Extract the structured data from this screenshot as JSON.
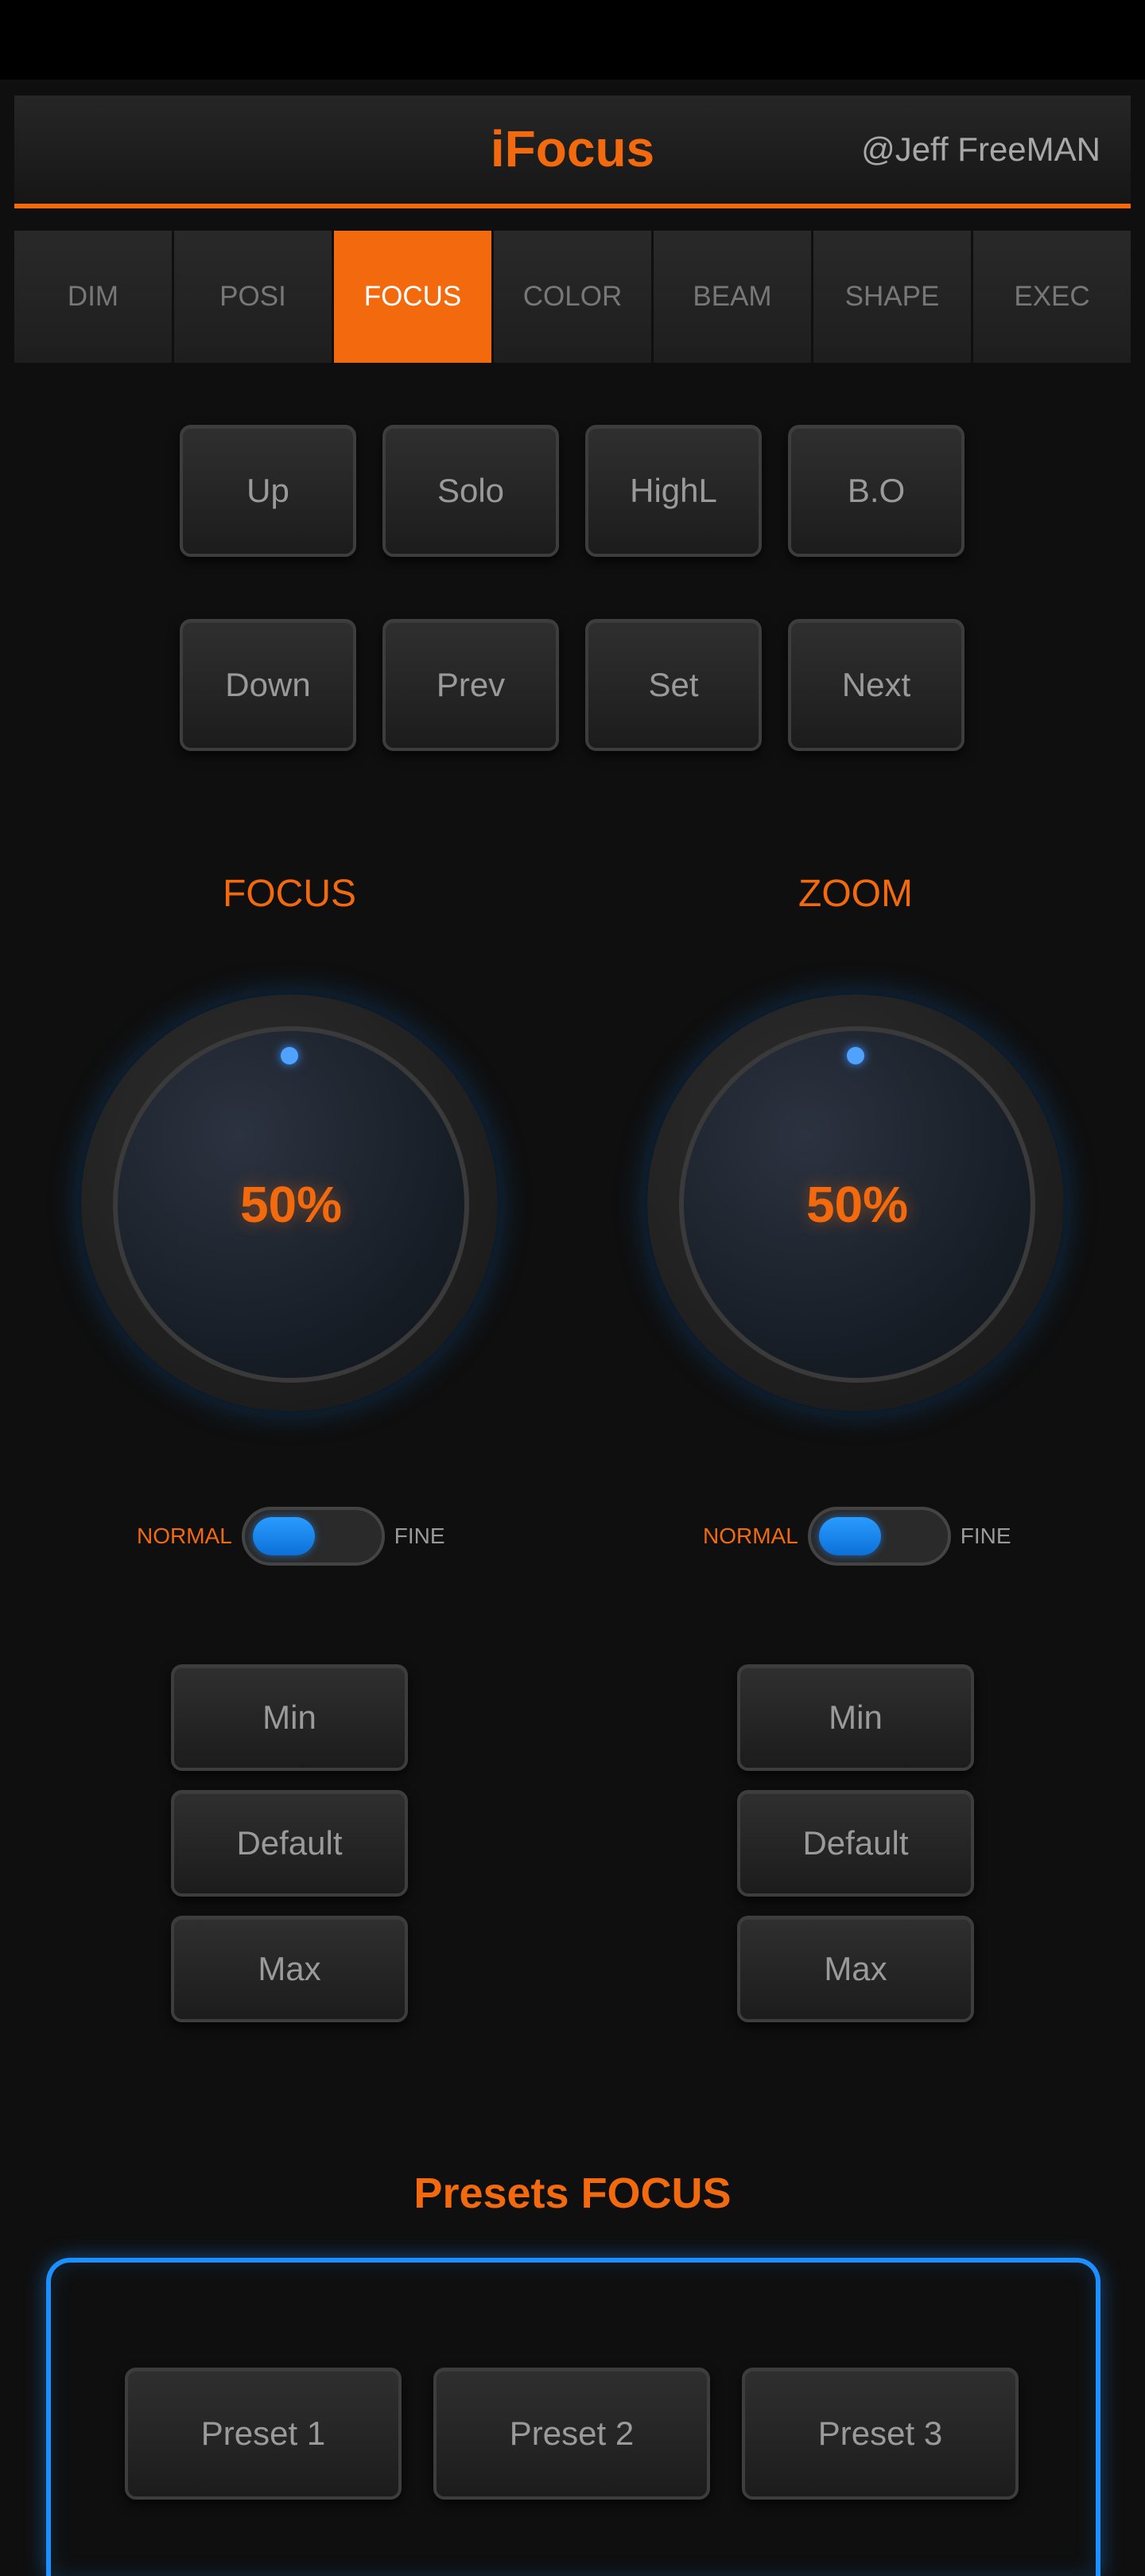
{
  "header": {
    "title": "iFocus",
    "user": "@Jeff FreeMAN"
  },
  "tabs": [
    {
      "label": "DIM",
      "active": false
    },
    {
      "label": "POSI",
      "active": false
    },
    {
      "label": "FOCUS",
      "active": true
    },
    {
      "label": "COLOR",
      "active": false
    },
    {
      "label": "BEAM",
      "active": false
    },
    {
      "label": "SHAPE",
      "active": false
    },
    {
      "label": "EXEC",
      "active": false
    }
  ],
  "controls": {
    "row1": [
      "Up",
      "Solo",
      "HighL",
      "B.O"
    ],
    "row2": [
      "Down",
      "Prev",
      "Set",
      "Next"
    ]
  },
  "knobs": [
    {
      "label": "FOCUS",
      "value": "50%",
      "level": 0.5,
      "mode_normal": "NORMAL",
      "mode_fine": "FINE",
      "buttons": [
        "Min",
        "Default",
        "Max"
      ]
    },
    {
      "label": "ZOOM",
      "value": "50%",
      "level": 0.5,
      "mode_normal": "NORMAL",
      "mode_fine": "FINE",
      "buttons": [
        "Min",
        "Default",
        "Max"
      ]
    }
  ],
  "presets": {
    "title": "Presets FOCUS",
    "items": [
      "Preset 1",
      "Preset 2",
      "Preset 3"
    ]
  },
  "colors": {
    "accent": "#f26a0d",
    "highlight": "#1e8fff",
    "background": "#0f0f0f"
  }
}
